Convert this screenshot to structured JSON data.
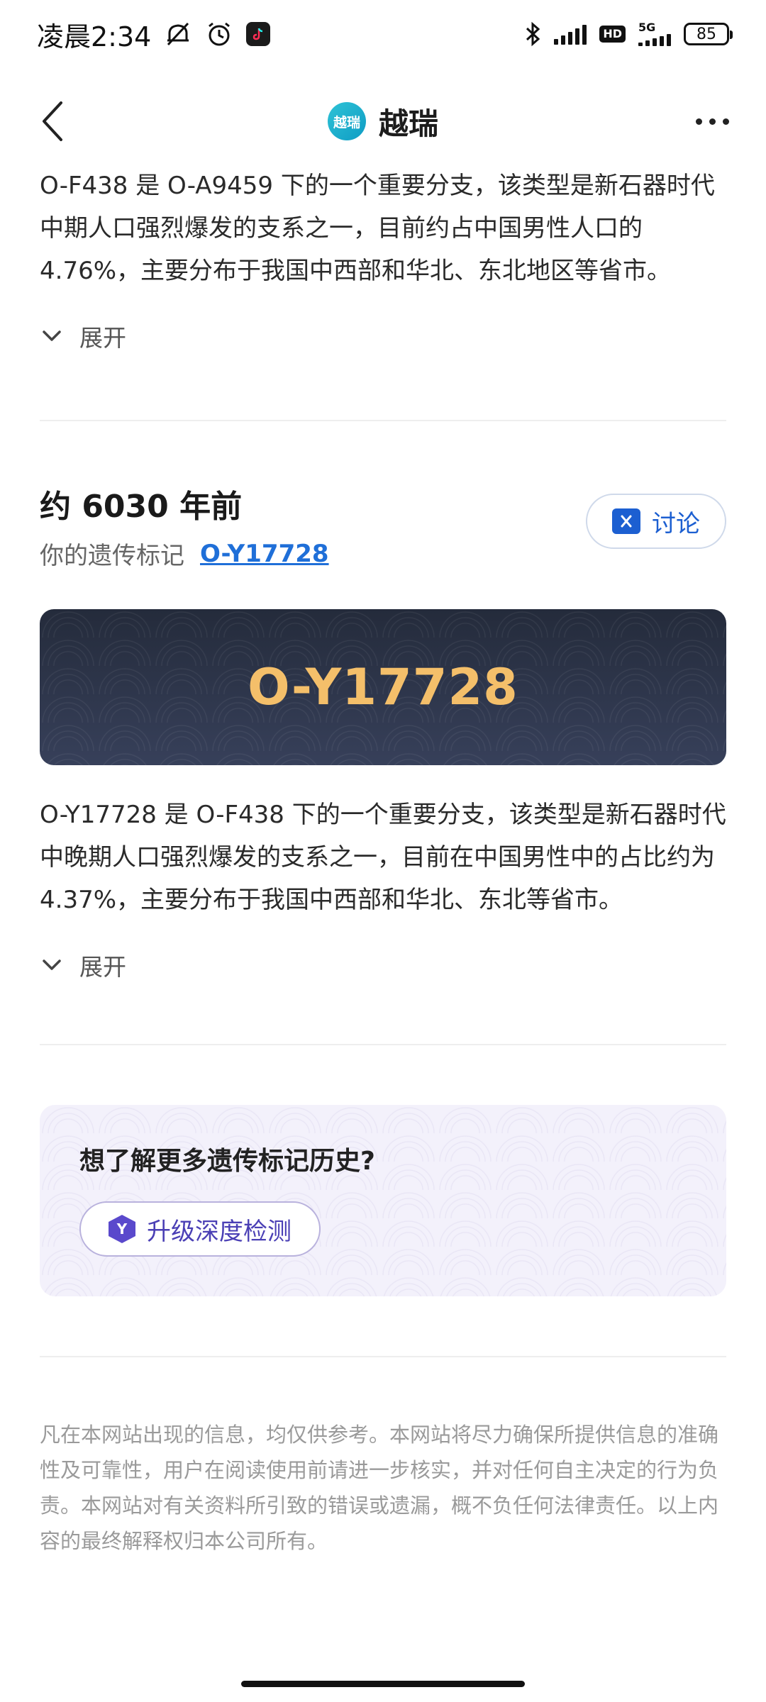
{
  "status_bar": {
    "time": "凌晨2:34",
    "network": "5G",
    "hd": "HD",
    "battery": "85"
  },
  "header": {
    "logo_text": "越瑞",
    "title": "越瑞"
  },
  "section1": {
    "paragraph": "O-F438 是 O-A9459 下的一个重要分支，该类型是新石器时代中期人口强烈爆发的支系之一，目前约占中国男性人口的 4.76%，主要分布于我国中西部和华北、东北地区等省市。",
    "expand_label": "展开"
  },
  "section2": {
    "age": "约 6030 年前",
    "marker_label": "你的遗传标记",
    "marker_link": "O-Y17728",
    "discuss_label": "讨论",
    "banner_text": "O-Y17728",
    "paragraph": "O-Y17728 是 O-F438 下的一个重要分支，该类型是新石器时代中晚期人口强烈爆发的支系之一，目前在中国男性中的占比约为 4.37%，主要分布于我国中西部和华北、东北等省市。",
    "expand_label": "展开"
  },
  "promo": {
    "title": "想了解更多遗传标记历史?",
    "button_icon_letter": "Y",
    "button_label": "升级深度检测"
  },
  "disclaimer": "凡在本网站出现的信息，均仅供参考。本网站将尽力确保所提供信息的准确性及可靠性，用户在阅读使用前请进一步核实，并对任何自主决定的行为负责。本网站对有关资料所引致的错误或遗漏，概不负任何法律责任。以上内容的最终解释权归本公司所有。"
}
